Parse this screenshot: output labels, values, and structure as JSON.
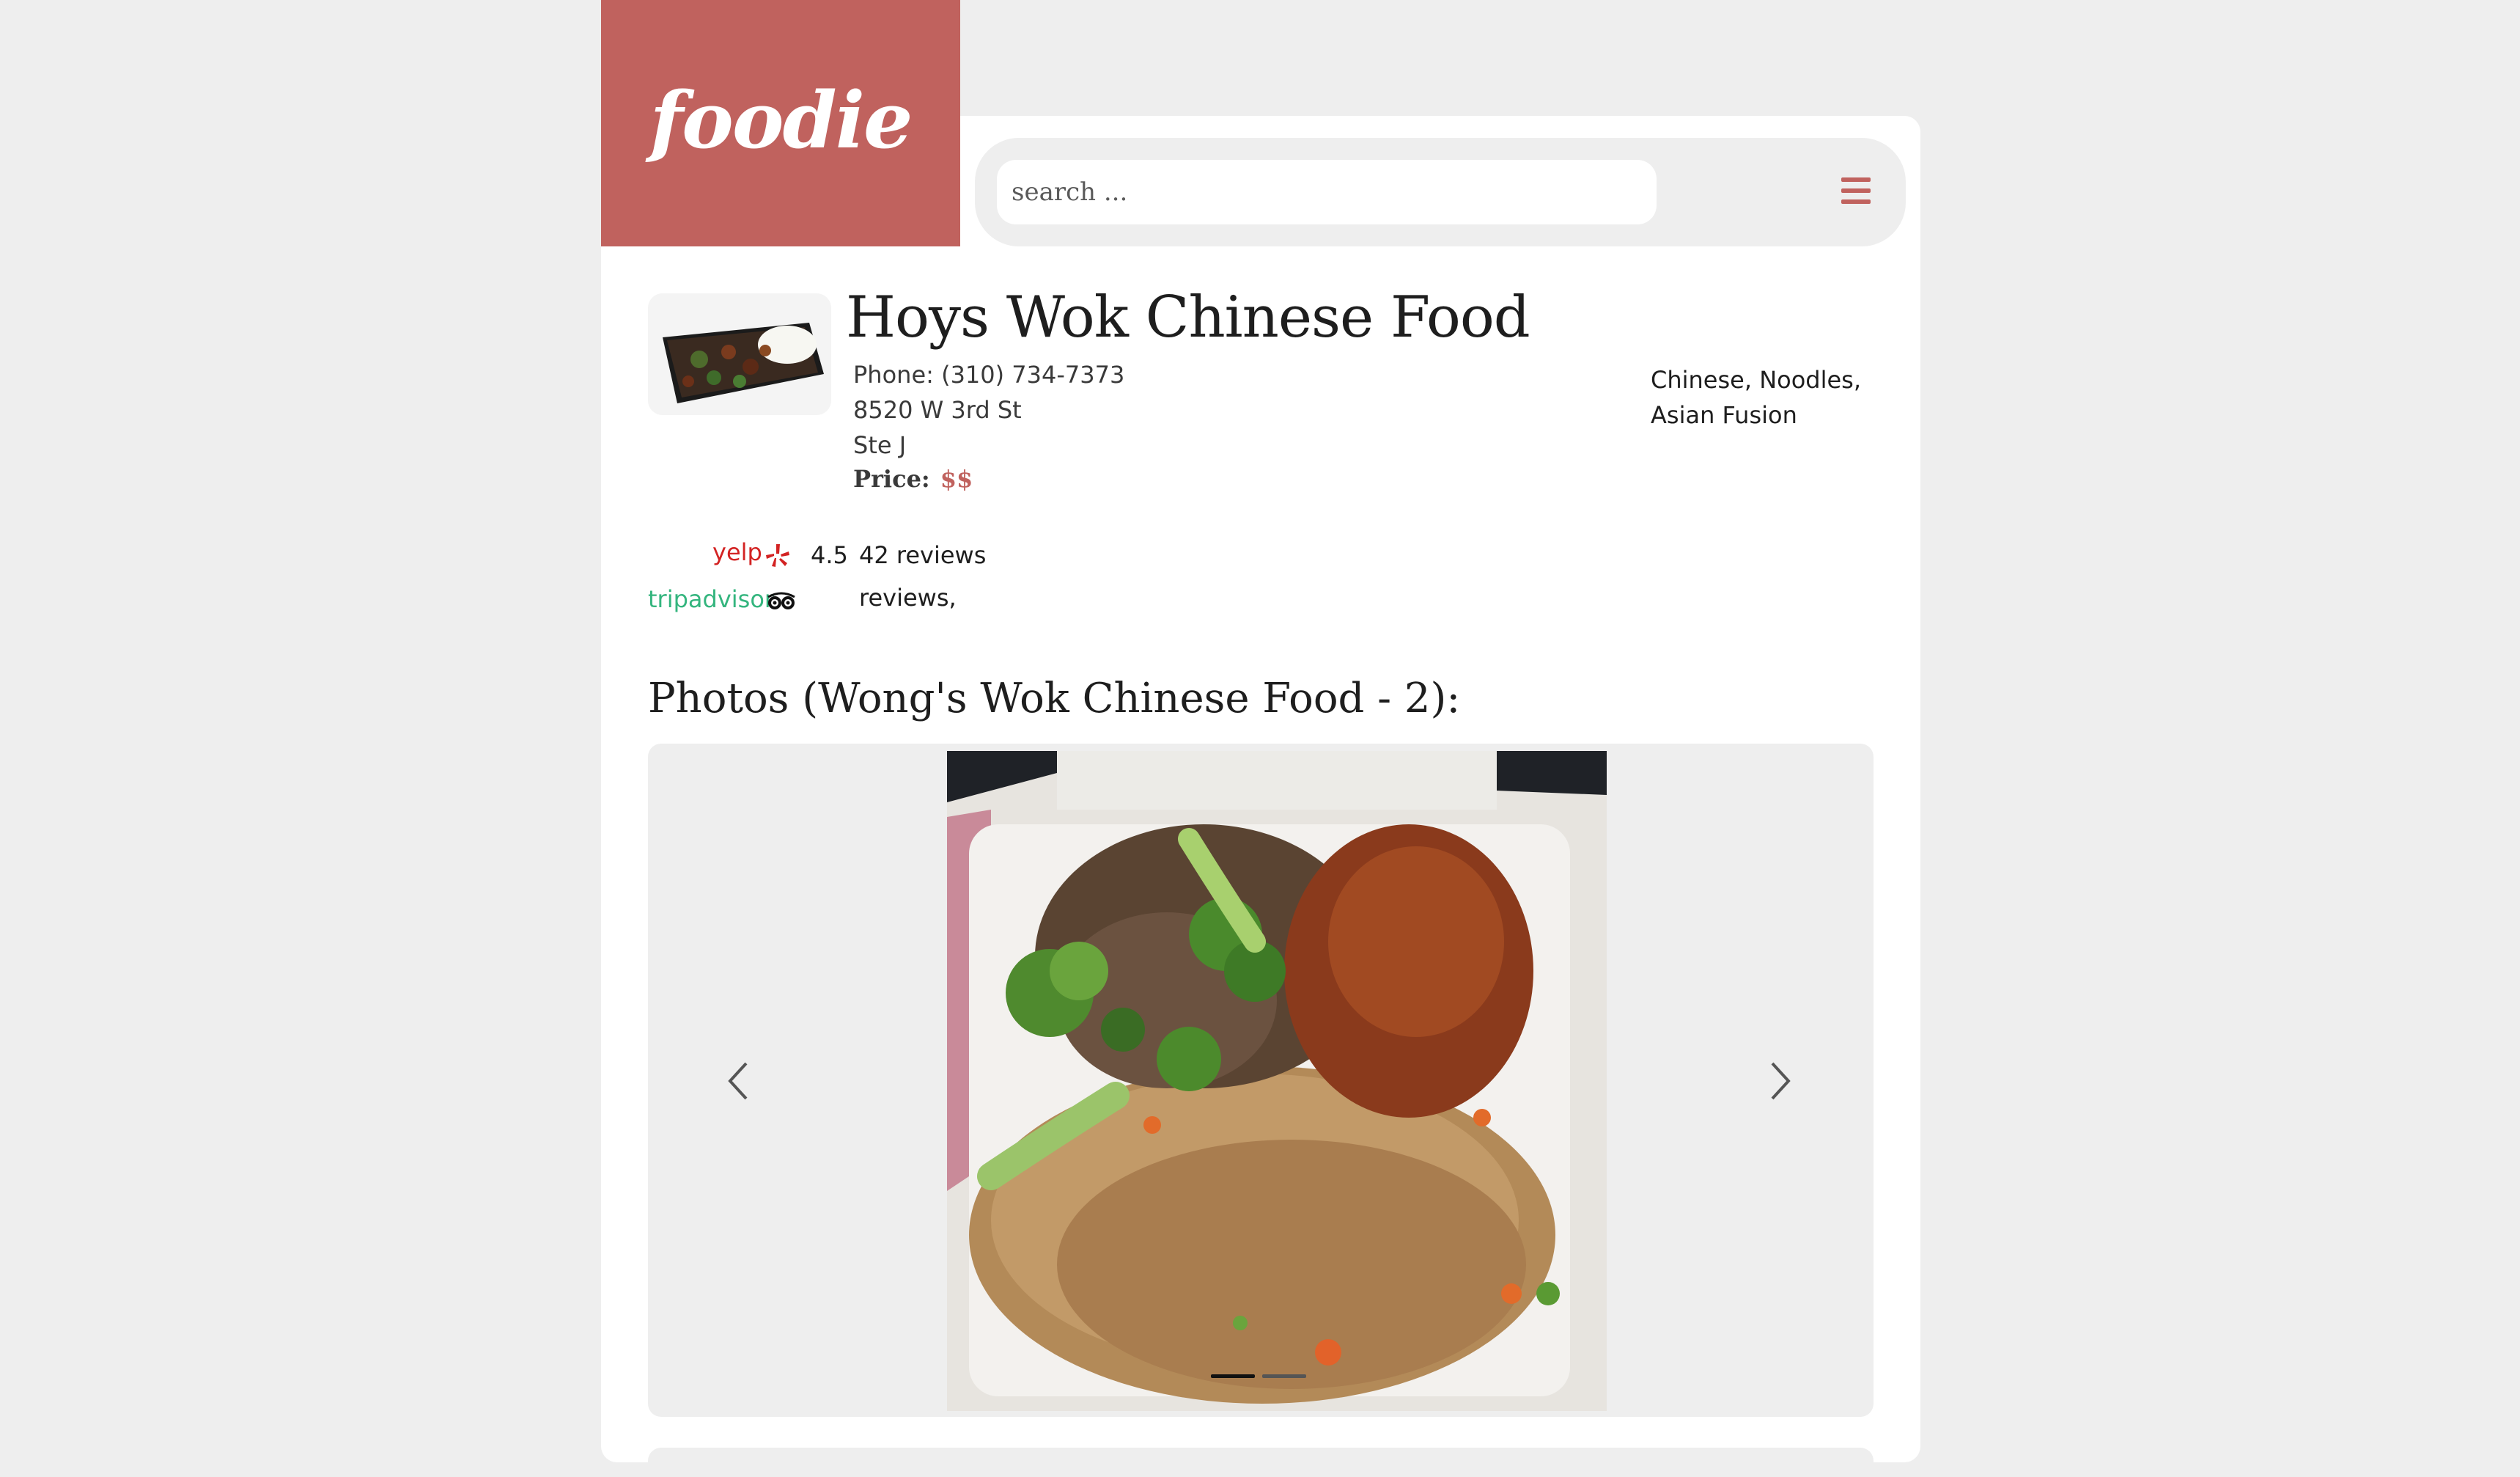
{
  "brand": {
    "logo_text": "foodie",
    "accent_color": "#c0625e"
  },
  "search": {
    "placeholder": "search ...",
    "value": ""
  },
  "header": {
    "menu_icon": "hamburger-menu-icon"
  },
  "restaurant": {
    "name": "Hoys Wok Chinese Food",
    "phone": "Phone: (310) 734-7373",
    "address_line1": "8520 W 3rd St",
    "address_line2": "Ste J",
    "price_label": "Price:",
    "price_value": "$$",
    "categories_line1": "Chinese, Noodles,",
    "categories_line2": "Asian Fusion"
  },
  "ratings": {
    "yelp": {
      "label": "yelp",
      "icon": "yelp-burst-icon",
      "rating": "4.5",
      "reviews": "42 reviews",
      "color": "#d32323"
    },
    "tripadvisor": {
      "label": "tripadvisor",
      "icon": "owl-eyes-icon",
      "reviews": "reviews,",
      "color": "#34b57e"
    }
  },
  "photos": {
    "heading": "Photos (Wong's Wok Chinese Food - 2):",
    "count": 2,
    "active_index": 0,
    "prev_icon": "chevron-left-icon",
    "next_icon": "chevron-right-icon"
  }
}
